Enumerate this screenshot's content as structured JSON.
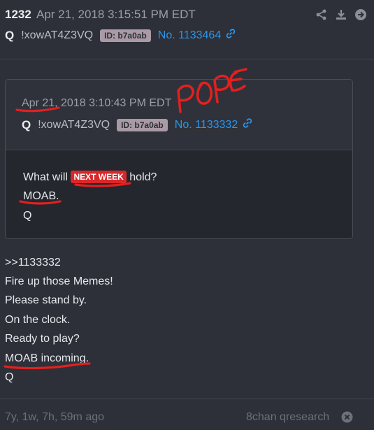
{
  "post": {
    "number": "1232",
    "timestamp": "Apr 21, 2018 3:15:51 PM EDT",
    "author": "Q",
    "tripcode": "!xowAT4Z3VQ",
    "id_badge": "ID: b7a0ab",
    "post_ref": "No. 1133464"
  },
  "quoted": {
    "timestamp": "Apr 21, 2018 3:10:43 PM EDT",
    "author": "Q",
    "tripcode": "!xowAT4Z3VQ",
    "id_badge": "ID: b7a0ab",
    "post_ref": "No. 1133332",
    "line1_before": "What will",
    "badge": "NEXT WEEK",
    "line1_after": "hold?",
    "line2": "MOAB.",
    "line3": "Q"
  },
  "annotation": {
    "handwritten": "POPE"
  },
  "body": {
    "lines": [
      ">>1133332",
      "Fire up those Memes!",
      "Please stand by.",
      "On the clock.",
      "Ready to play?",
      "MOAB incoming.",
      "Q"
    ]
  },
  "footer": {
    "age": "7y, 1w, 7h, 59m ago",
    "source": "8chan qresearch"
  },
  "colors": {
    "background": "#2d3038",
    "link": "#2a96ec",
    "badge_red": "#d8282a",
    "annotation_red": "#e3201f"
  }
}
